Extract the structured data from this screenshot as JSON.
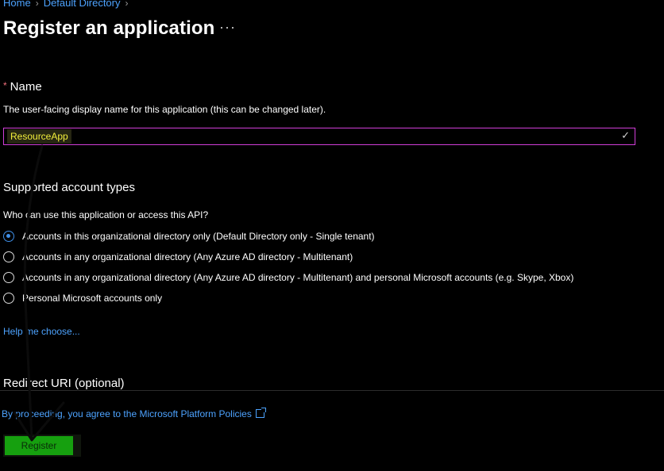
{
  "breadcrumb": {
    "items": [
      "Home",
      "Default Directory"
    ]
  },
  "page": {
    "title": "Register an application",
    "more_label": "···"
  },
  "name_section": {
    "required_marker": "*",
    "label": "Name",
    "description": "The user-facing display name for this application (this can be changed later).",
    "input_value": "ResourceApp",
    "valid_icon": "check-icon"
  },
  "account_types": {
    "heading": "Supported account types",
    "question": "Who can use this application or access this API?",
    "options": [
      {
        "label": "Accounts in this organizational directory only (Default Directory only - Single tenant)",
        "selected": true
      },
      {
        "label": "Accounts in any organizational directory (Any Azure AD directory - Multitenant)",
        "selected": false
      },
      {
        "label": "Accounts in any organizational directory (Any Azure AD directory - Multitenant) and personal Microsoft accounts (e.g. Skype, Xbox)",
        "selected": false
      },
      {
        "label": "Personal Microsoft accounts only",
        "selected": false
      }
    ],
    "help_link": "Help me choose..."
  },
  "redirect": {
    "heading": "Redirect URI (optional)"
  },
  "footer": {
    "policy_text": "By proceeding, you agree to the Microsoft Platform Policies",
    "register_label": "Register"
  },
  "colors": {
    "link": "#4da3ff",
    "input_border": "#d13ed8",
    "register_bg": "#16a00f",
    "highlight_text": "#f3ef3b",
    "radio_selected": "#3f8fe8"
  }
}
